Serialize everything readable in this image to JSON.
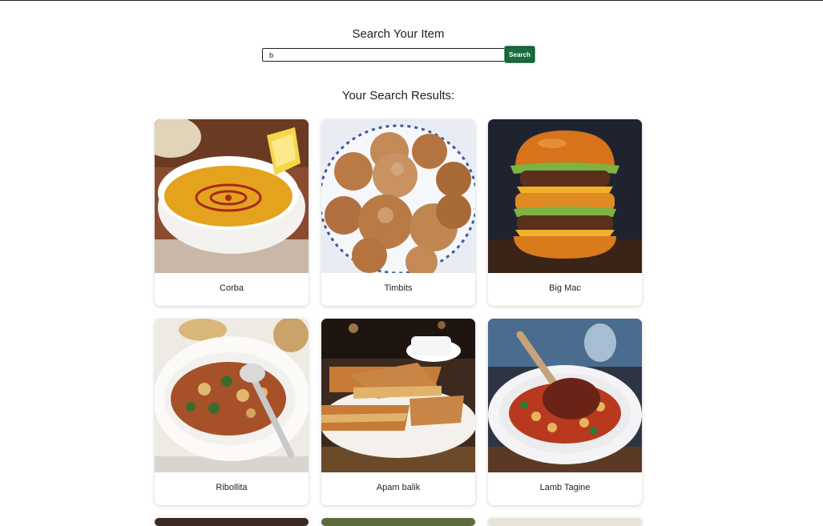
{
  "search": {
    "title": "Search Your Item",
    "query": "b",
    "button_label": "Search"
  },
  "results": {
    "title": "Your Search Results:",
    "items": [
      {
        "name": "Corba",
        "image": "bowl of red lentil soup with lemon wedge"
      },
      {
        "name": "Timbits",
        "image": "sugar-dusted doughnut holes on a plate"
      },
      {
        "name": "Big Mac",
        "image": "double cheeseburger with lettuce"
      },
      {
        "name": "Ribollita",
        "image": "bowl of vegetable and bean stew"
      },
      {
        "name": "Apam balik",
        "image": "folded peanut pancake slices on a plate"
      },
      {
        "name": "Lamb Tagine",
        "image": "lamb shank with chickpeas and tomato"
      }
    ]
  }
}
